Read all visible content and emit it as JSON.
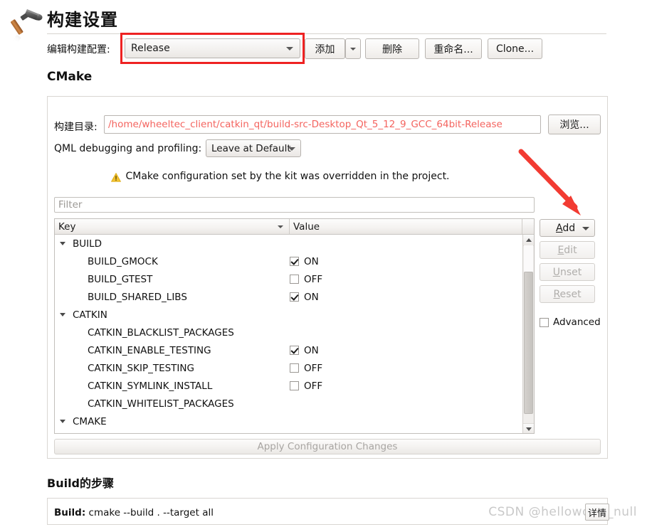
{
  "header": {
    "icon": "hammer-icon",
    "title": "构建设置"
  },
  "config_row": {
    "label": "编辑构建配置:",
    "selected": "Release",
    "buttons": {
      "add": "添加",
      "remove": "删除",
      "rename": "重命名...",
      "clone": "Clone..."
    },
    "highlight_color": "#ee2222"
  },
  "cmake": {
    "heading": "CMake",
    "build_dir_label": "构建目录:",
    "build_dir_value": "/home/wheeltec_client/catkin_qt/build-src-Desktop_Qt_5_12_9_GCC_64bit-Release",
    "build_dir_color": "#f4645f",
    "browse_label": "浏览...",
    "qml_label": "QML debugging and profiling:",
    "qml_value": "Leave at Default",
    "warning_icon": "warning-triangle-icon",
    "warning_text": "CMake configuration set by the kit was overridden in the project.",
    "filter_placeholder": "Filter",
    "filter_value": "",
    "table": {
      "columns": [
        "Key",
        "Value"
      ],
      "rows": [
        {
          "type": "group",
          "key": "BUILD",
          "value": "",
          "checked": null
        },
        {
          "type": "item",
          "key": "BUILD_GMOCK",
          "value": "ON",
          "checked": true
        },
        {
          "type": "item",
          "key": "BUILD_GTEST",
          "value": "OFF",
          "checked": false
        },
        {
          "type": "item",
          "key": "BUILD_SHARED_LIBS",
          "value": "ON",
          "checked": true
        },
        {
          "type": "group",
          "key": "CATKIN",
          "value": "",
          "checked": null
        },
        {
          "type": "item",
          "key": "CATKIN_BLACKLIST_PACKAGES",
          "value": "",
          "checked": null
        },
        {
          "type": "item",
          "key": "CATKIN_ENABLE_TESTING",
          "value": "ON",
          "checked": true
        },
        {
          "type": "item",
          "key": "CATKIN_SKIP_TESTING",
          "value": "OFF",
          "checked": false
        },
        {
          "type": "item",
          "key": "CATKIN_SYMLINK_INSTALL",
          "value": "OFF",
          "checked": false
        },
        {
          "type": "item",
          "key": "CATKIN_WHITELIST_PACKAGES",
          "value": "",
          "checked": null
        },
        {
          "type": "group",
          "key": "CMAKE",
          "value": "",
          "checked": null
        }
      ]
    },
    "side_buttons": [
      {
        "label": "Add",
        "mnemonic": "A",
        "disabled": false,
        "has_dropdown": true
      },
      {
        "label": "Edit",
        "mnemonic": "E",
        "disabled": true,
        "has_dropdown": false
      },
      {
        "label": "Unset",
        "mnemonic": "U",
        "disabled": true,
        "has_dropdown": false
      },
      {
        "label": "Reset",
        "mnemonic": "R",
        "disabled": true,
        "has_dropdown": false
      }
    ],
    "advanced_label": "Advanced",
    "advanced_checked": false,
    "apply_label": "Apply Configuration Changes",
    "apply_disabled": true
  },
  "build_steps": {
    "heading": "Build的步骤",
    "step_prefix": "Build:",
    "step_command": "cmake --build . --target all",
    "details_label": "详情"
  },
  "watermark": "CSDN @helloworld_null"
}
